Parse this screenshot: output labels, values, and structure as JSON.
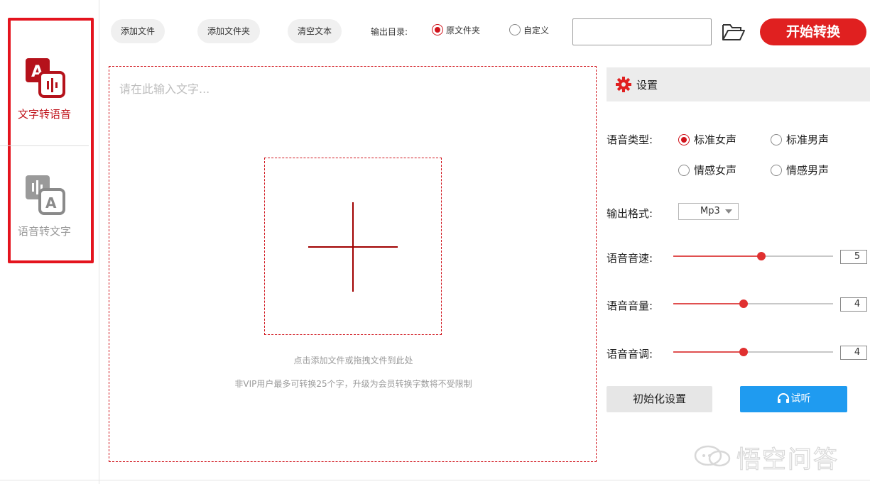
{
  "sidebar": {
    "items": [
      {
        "label": "文字转语音",
        "icon": "text-to-speech-icon",
        "active": true
      },
      {
        "label": "语音转文字",
        "icon": "speech-to-text-icon",
        "active": false
      }
    ]
  },
  "toolbar": {
    "add_file": "添加文件",
    "add_folder": "添加文件夹",
    "clear_text": "清空文本",
    "output_dir_label": "输出目录:",
    "output_original": "原文件夹",
    "output_custom": "自定义",
    "output_selected": "原文件夹",
    "path_value": "",
    "folder_icon": "folder-open-icon",
    "start_label": "开始转换"
  },
  "editor": {
    "placeholder": "请在此输入文字...",
    "hint_line1": "点击添加文件或拖拽文件到此处",
    "hint_line2": "非VIP用户最多可转换25个字，升级为会员转换字数将不受限制"
  },
  "settings": {
    "title": "设置",
    "voice_type_label": "语音类型:",
    "voice_options": [
      "标准女声",
      "标准男声",
      "情感女声",
      "情感男声"
    ],
    "voice_selected": "标准女声",
    "format_label": "输出格式:",
    "format_value": "Mp3",
    "speed_label": "语音音速:",
    "speed_value": "5",
    "speed_fraction": 0.55,
    "volume_label": "语音音量:",
    "volume_value": "4",
    "volume_fraction": 0.44,
    "pitch_label": "语音音调:",
    "pitch_value": "4",
    "pitch_fraction": 0.44,
    "init_label": "初始化设置",
    "listen_label": "试听"
  },
  "colors": {
    "accent_red": "#e02020",
    "listen_blue": "#1f9bf0"
  },
  "watermark": {
    "text": "悟空问答"
  }
}
